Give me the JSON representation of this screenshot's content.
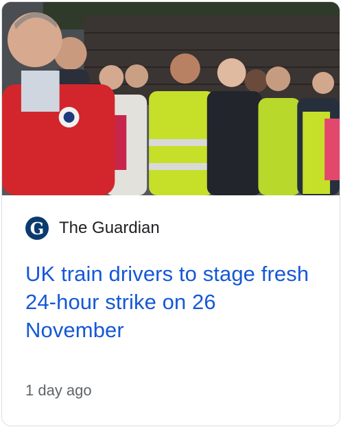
{
  "article": {
    "source": "The Guardian",
    "source_logo_letter": "G",
    "headline": "UK train drivers to stage fresh 24-hour strike on 26 November",
    "time_ago": "1 day ago"
  },
  "colors": {
    "headline": "#1558d6",
    "source_text": "#202124",
    "time_text": "#5f6368",
    "border": "#dadce0",
    "logo_bg": "#0b3a6e"
  }
}
